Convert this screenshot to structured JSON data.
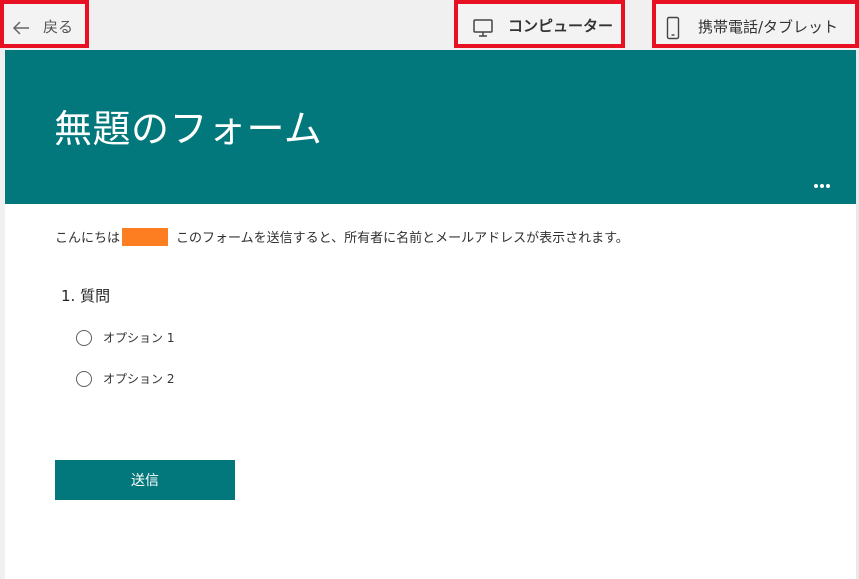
{
  "toolbar": {
    "back_label": "戻る",
    "computer_label": "コンピューター",
    "mobile_label": "携帯電話/タブレット"
  },
  "form": {
    "title": "無題のフォーム",
    "greeting_prefix": "こんにちは",
    "greeting_suffix": "このフォームを送信すると、所有者に名前とメールアドレスが表示されます。",
    "question": "1. 質問",
    "options": [
      "オプション 1",
      "オプション 2"
    ],
    "submit_label": "送信"
  },
  "colors": {
    "theme": "#03787c",
    "highlight_border": "#e81123",
    "redaction": "#fd7e21"
  },
  "icons": {
    "back": "arrow-left-icon",
    "computer": "monitor-icon",
    "mobile": "phone-icon",
    "more": "more-horizontal-icon"
  }
}
